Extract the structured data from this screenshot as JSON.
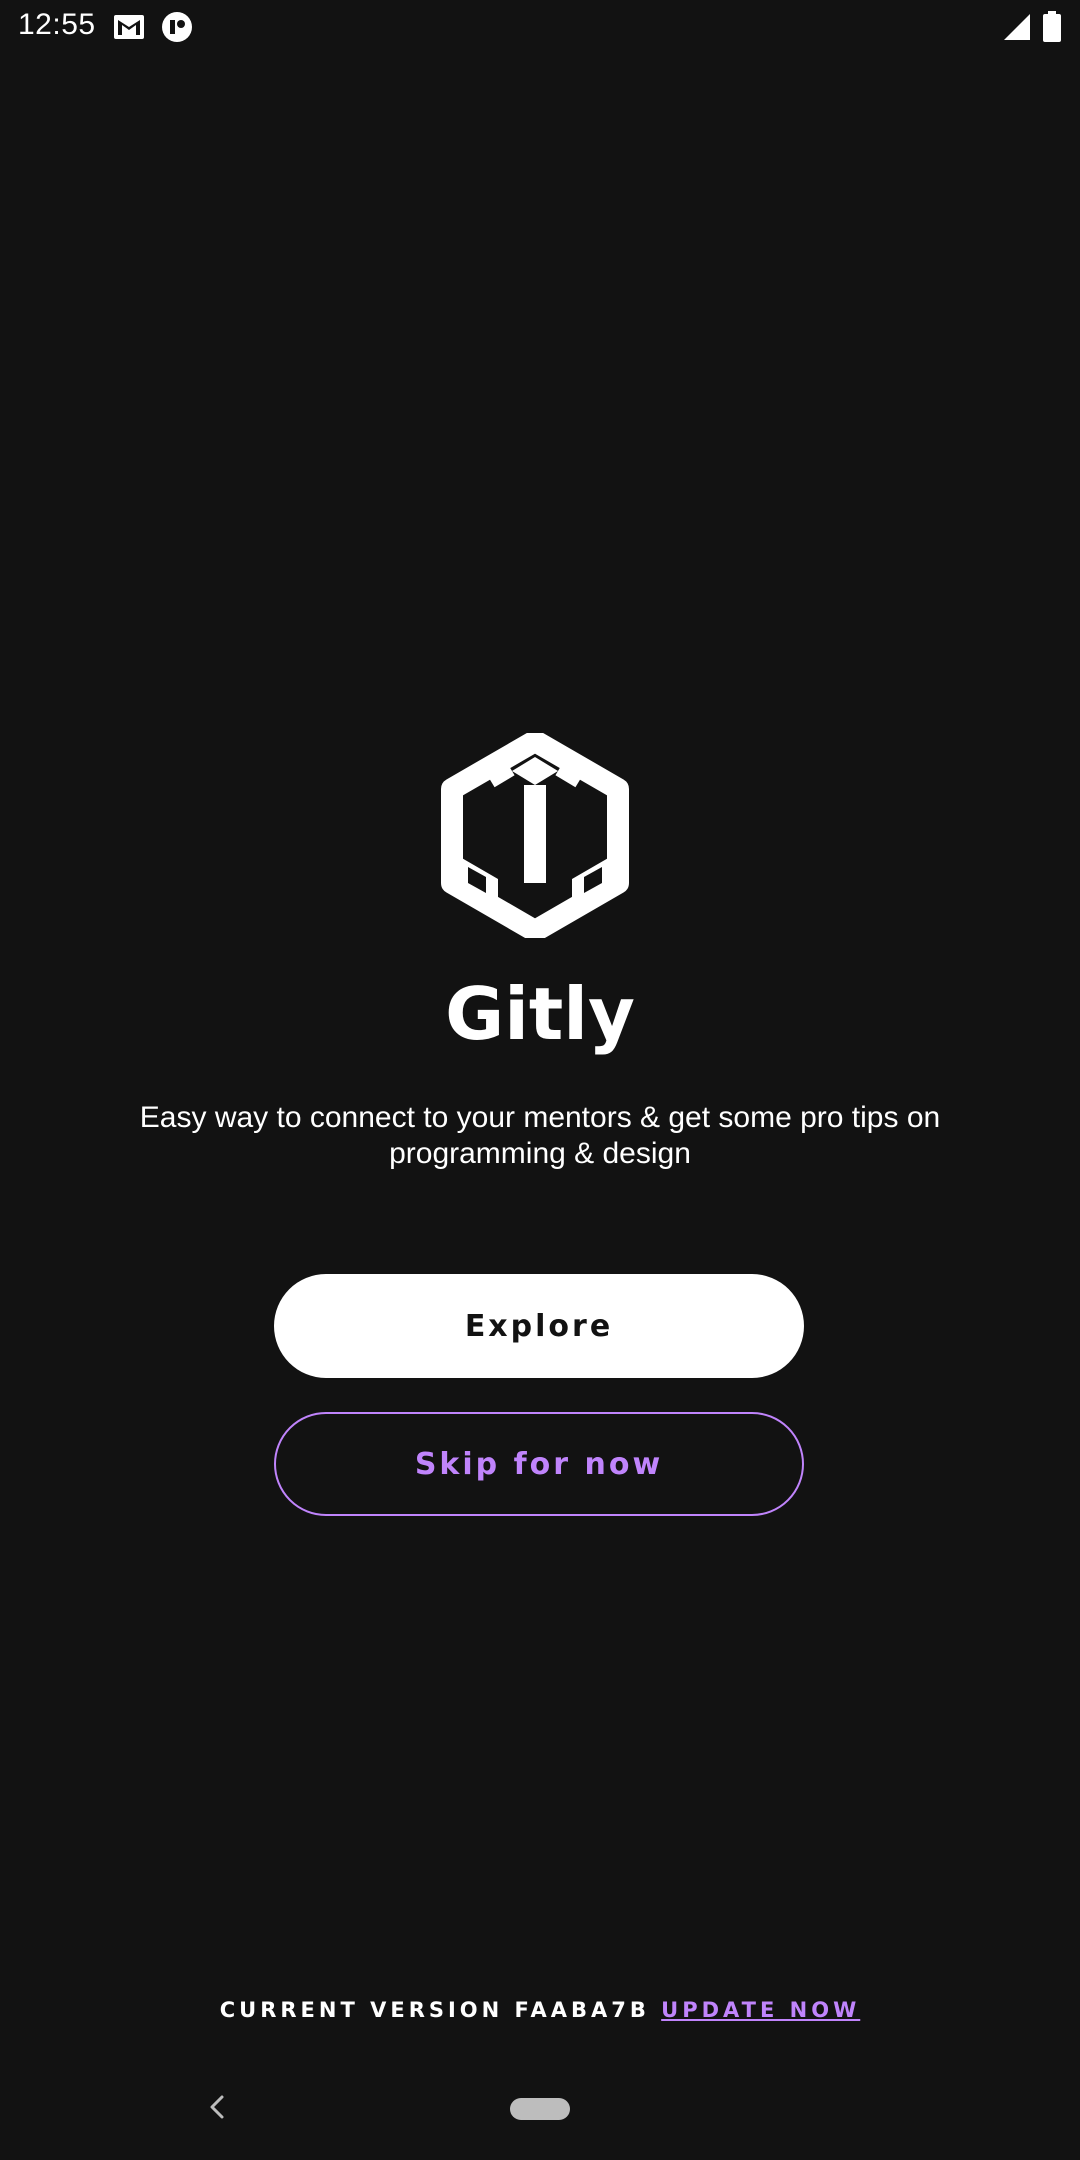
{
  "status_bar": {
    "time": "12:55",
    "icons": [
      "gmail-icon",
      "app-notification-icon",
      "signal-icon",
      "battery-icon"
    ]
  },
  "app": {
    "logo_icon": "cube-hexagon-logo-icon",
    "title": "Gitly",
    "tagline": "Easy way to connect to your mentors & get some pro tips on programming & design"
  },
  "actions": {
    "explore_label": "Explore",
    "skip_label": "Skip for now"
  },
  "footer": {
    "version_text": "CURRENT VERSION FAABA7B",
    "update_label": "UPDATE NOW"
  },
  "nav_bar": {
    "icons": [
      "back-icon",
      "home-pill-icon"
    ]
  },
  "colors": {
    "background": "#121212",
    "primary_text": "#ffffff",
    "accent": "#c084fc"
  }
}
